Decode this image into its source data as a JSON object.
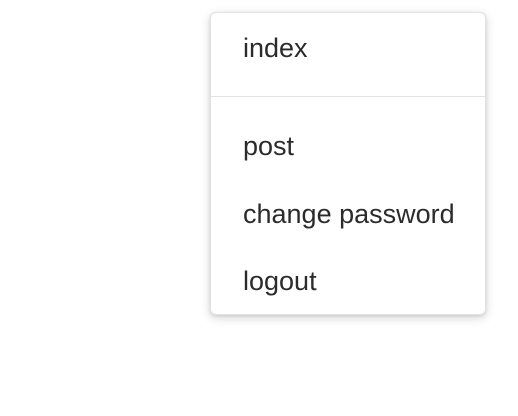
{
  "menu": {
    "items": [
      {
        "label": "index"
      },
      {
        "label": "post"
      },
      {
        "label": "change password"
      },
      {
        "label": "logout"
      }
    ]
  }
}
